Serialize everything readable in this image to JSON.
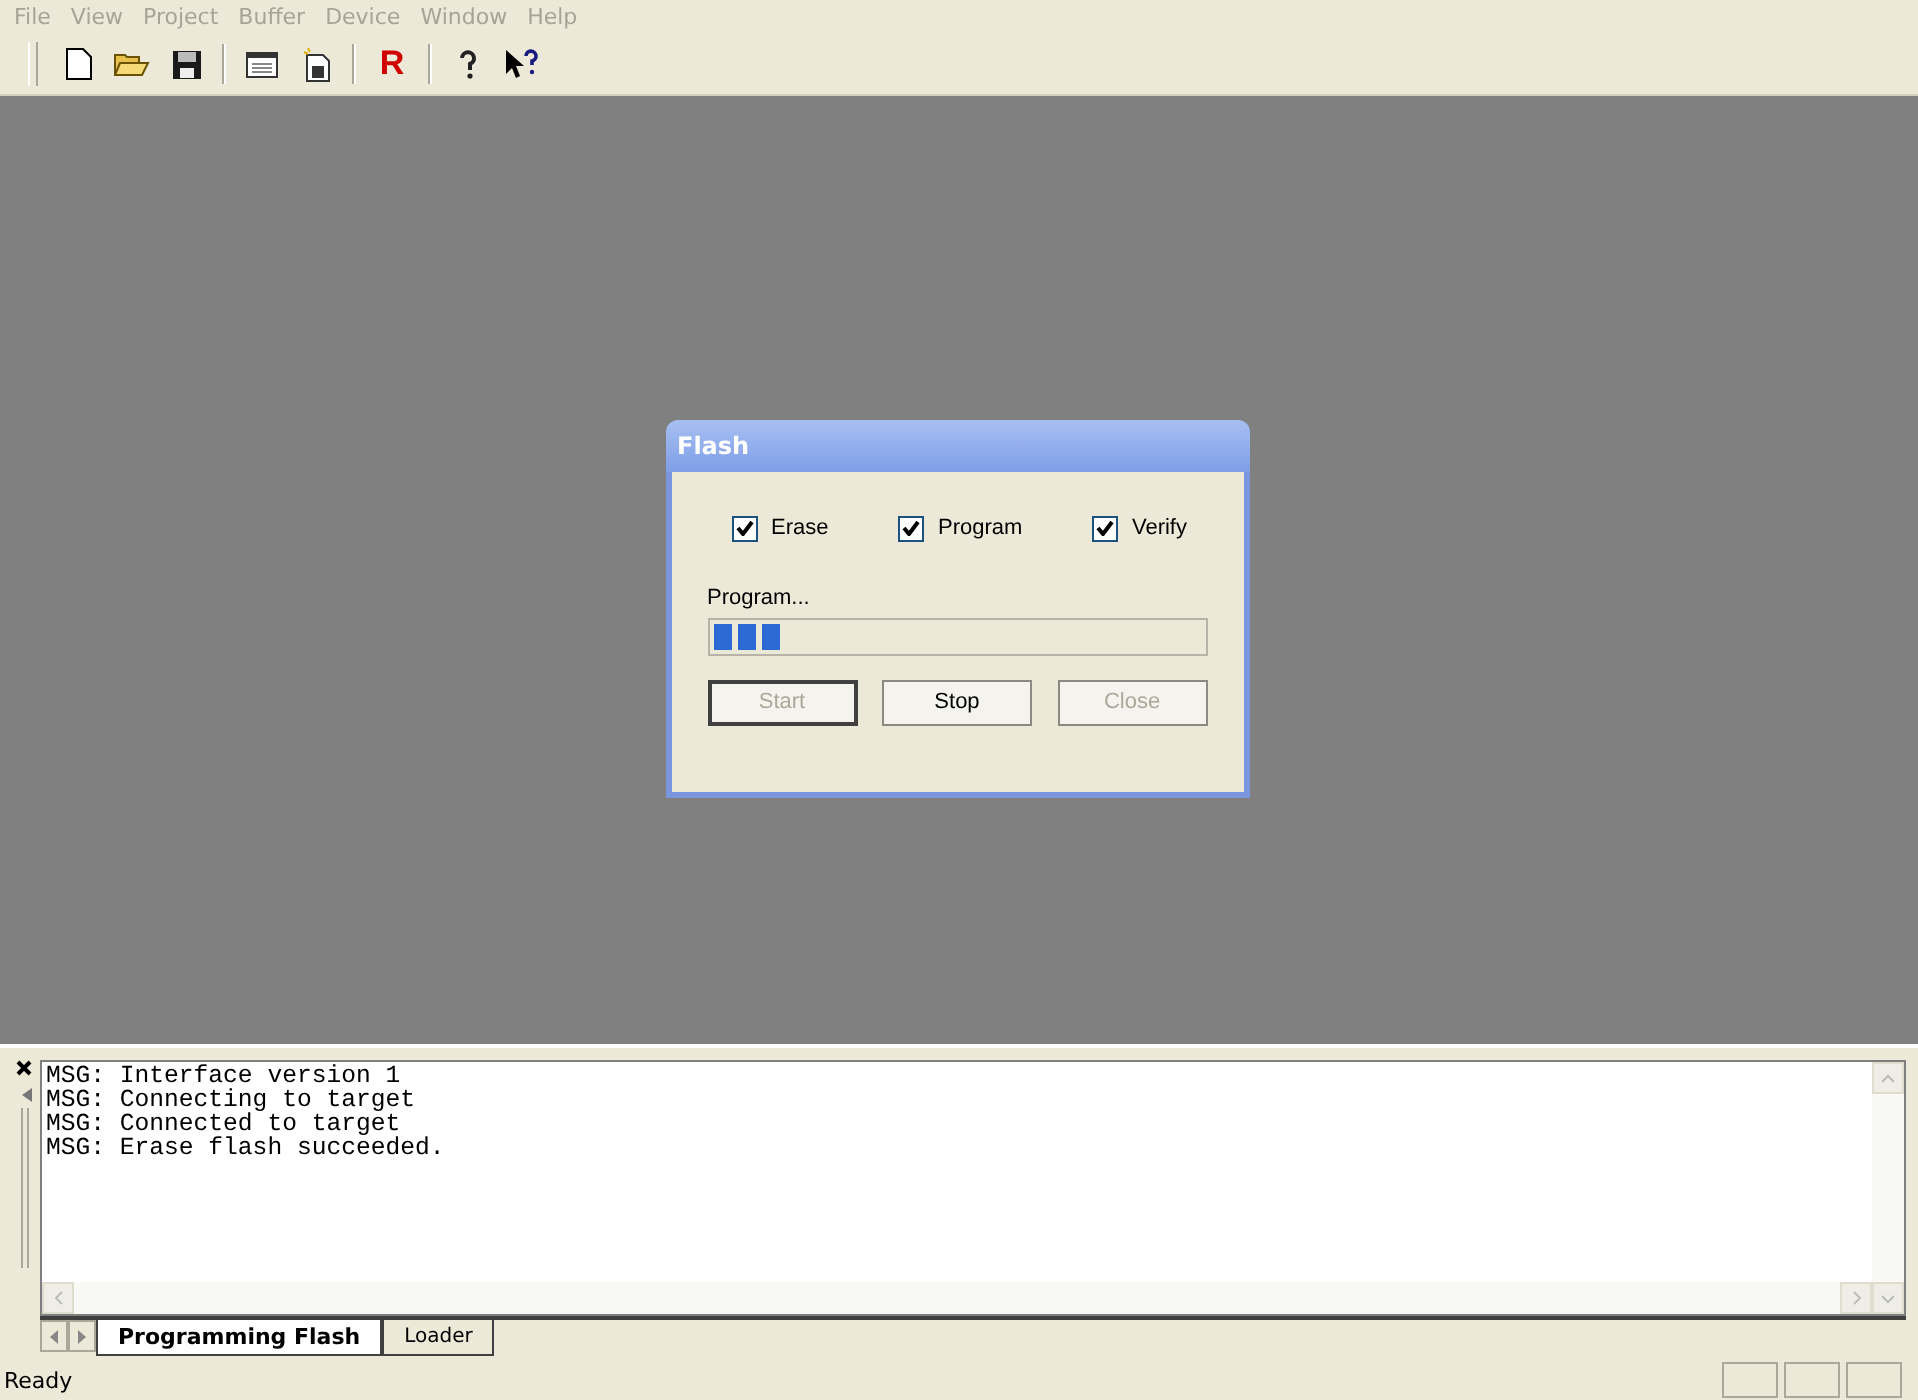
{
  "menu": [
    {
      "label": "File",
      "disabled": true
    },
    {
      "label": "View",
      "disabled": true
    },
    {
      "label": "Project",
      "disabled": true
    },
    {
      "label": "Buffer",
      "disabled": true
    },
    {
      "label": "Device",
      "disabled": true
    },
    {
      "label": "Window",
      "disabled": true
    },
    {
      "label": "Help",
      "disabled": true
    }
  ],
  "toolbar": [
    {
      "kind": "new"
    },
    {
      "kind": "open"
    },
    {
      "kind": "save"
    },
    {
      "kind": "sep"
    },
    {
      "kind": "window"
    },
    {
      "kind": "binary"
    },
    {
      "kind": "sep"
    },
    {
      "kind": "letter",
      "label": "R"
    },
    {
      "kind": "sep"
    },
    {
      "kind": "help"
    },
    {
      "kind": "whatsthis"
    }
  ],
  "dialog": {
    "title": "Flash",
    "options": [
      {
        "label": "Erase",
        "checked": true
      },
      {
        "label": "Program",
        "checked": true
      },
      {
        "label": "Verify",
        "checked": true
      }
    ],
    "progress": {
      "label": "Program...",
      "level": 0.15
    },
    "buttons": [
      {
        "label": "Start",
        "disabled": true,
        "default": true
      },
      {
        "label": "Stop",
        "disabled": false,
        "default": false
      },
      {
        "label": "Close",
        "disabled": true,
        "default": false
      }
    ]
  },
  "output": {
    "lines": [
      "MSG: Interface version 1",
      "MSG: Connecting to target",
      "MSG: Connected to target",
      "MSG: Erase flash succeeded."
    ],
    "tabs": [
      {
        "label": "Programming Flash",
        "selected": true
      },
      {
        "label": "Loader",
        "selected": false
      }
    ]
  },
  "status_bar": {
    "text": "Ready"
  }
}
